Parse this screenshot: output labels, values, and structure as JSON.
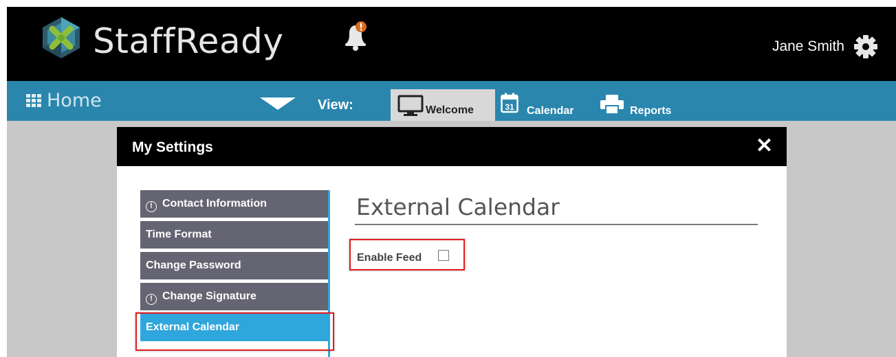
{
  "app": {
    "brand": "StaffReady"
  },
  "header": {
    "user_name": "Jane Smith"
  },
  "nav": {
    "home_label": "Home",
    "view_label": "View:",
    "tabs": [
      {
        "label": "Welcome",
        "icon": "monitor-icon",
        "active": true
      },
      {
        "label": "Calendar",
        "icon": "calendar-icon",
        "active": false
      },
      {
        "label": "Reports",
        "icon": "printer-icon",
        "active": false
      }
    ]
  },
  "modal": {
    "title": "My Settings",
    "close_label": "✕",
    "menu": [
      {
        "label": "Contact Information",
        "warning": true,
        "active": false
      },
      {
        "label": "Time Format",
        "warning": false,
        "active": false
      },
      {
        "label": "Change Password",
        "warning": false,
        "active": false
      },
      {
        "label": "Change Signature",
        "warning": true,
        "active": false
      },
      {
        "label": "External Calendar",
        "warning": false,
        "active": true
      }
    ],
    "section_title": "External Calendar",
    "enable_feed_label": "Enable Feed",
    "enable_feed_checked": false
  },
  "colors": {
    "topbar": "#000000",
    "navbar": "#2a86ad",
    "menu_item": "#656472",
    "menu_active": "#2fa6dc",
    "highlight": "#e21c1c"
  }
}
